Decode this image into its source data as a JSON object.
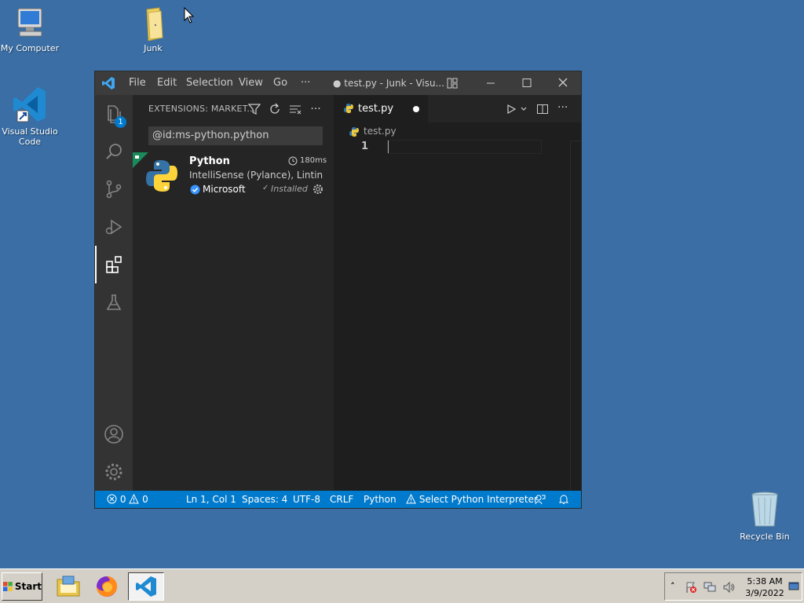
{
  "desktop": {
    "icons": [
      {
        "label": "My Computer"
      },
      {
        "label": "Junk"
      },
      {
        "label": "Visual Studio Code"
      },
      {
        "label": "Recycle Bin"
      }
    ]
  },
  "vscode": {
    "menu": [
      "File",
      "Edit",
      "Selection",
      "View",
      "Go",
      "···"
    ],
    "window_title": "● test.py - Junk - Visu...",
    "explorer_badge": "1",
    "sidebar": {
      "title": "EXTENSIONS: MARKET...",
      "search_value": "@id:ms-python.python",
      "extension": {
        "name": "Python",
        "time": "180ms",
        "description": "IntelliSense (Pylance), Lintin...",
        "publisher": "Microsoft",
        "status": "Installed"
      }
    },
    "editor": {
      "tab_label": "test.py",
      "breadcrumb": "test.py",
      "line_number": "1"
    },
    "status_bar": {
      "errors": "0",
      "warnings": "0",
      "position": "Ln 1, Col 1",
      "spaces": "Spaces: 4",
      "encoding": "UTF-8",
      "eol": "CRLF",
      "language": "Python",
      "interpreter": "Select Python Interpreter"
    },
    "colors": {
      "accent": "#007acc",
      "titlebar": "#3c3c3c",
      "activity": "#333333",
      "sidebar": "#252526",
      "editor": "#1e1e1e"
    }
  },
  "taskbar": {
    "start_label": "Start",
    "clock_time": "5:38 AM",
    "clock_date": "3/9/2022"
  }
}
